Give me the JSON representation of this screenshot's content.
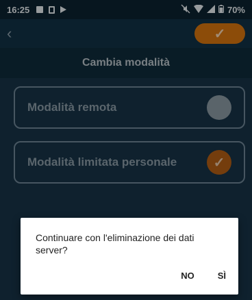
{
  "statusbar": {
    "time": "16:25",
    "battery": "70%"
  },
  "appbar": {
    "back_icon": "chevron-left",
    "confirm_icon": "check"
  },
  "title": "Cambia modalità",
  "options": [
    {
      "label": "Modalità remota",
      "selected": false
    },
    {
      "label": "Modalità limitata personale",
      "selected": true
    }
  ],
  "dialog": {
    "message": "Continuare con l'eliminazione dei dati server?",
    "no_label": "NO",
    "yes_label": "SÌ"
  },
  "colors": {
    "accent": "#d7750f",
    "background": "#173447"
  }
}
